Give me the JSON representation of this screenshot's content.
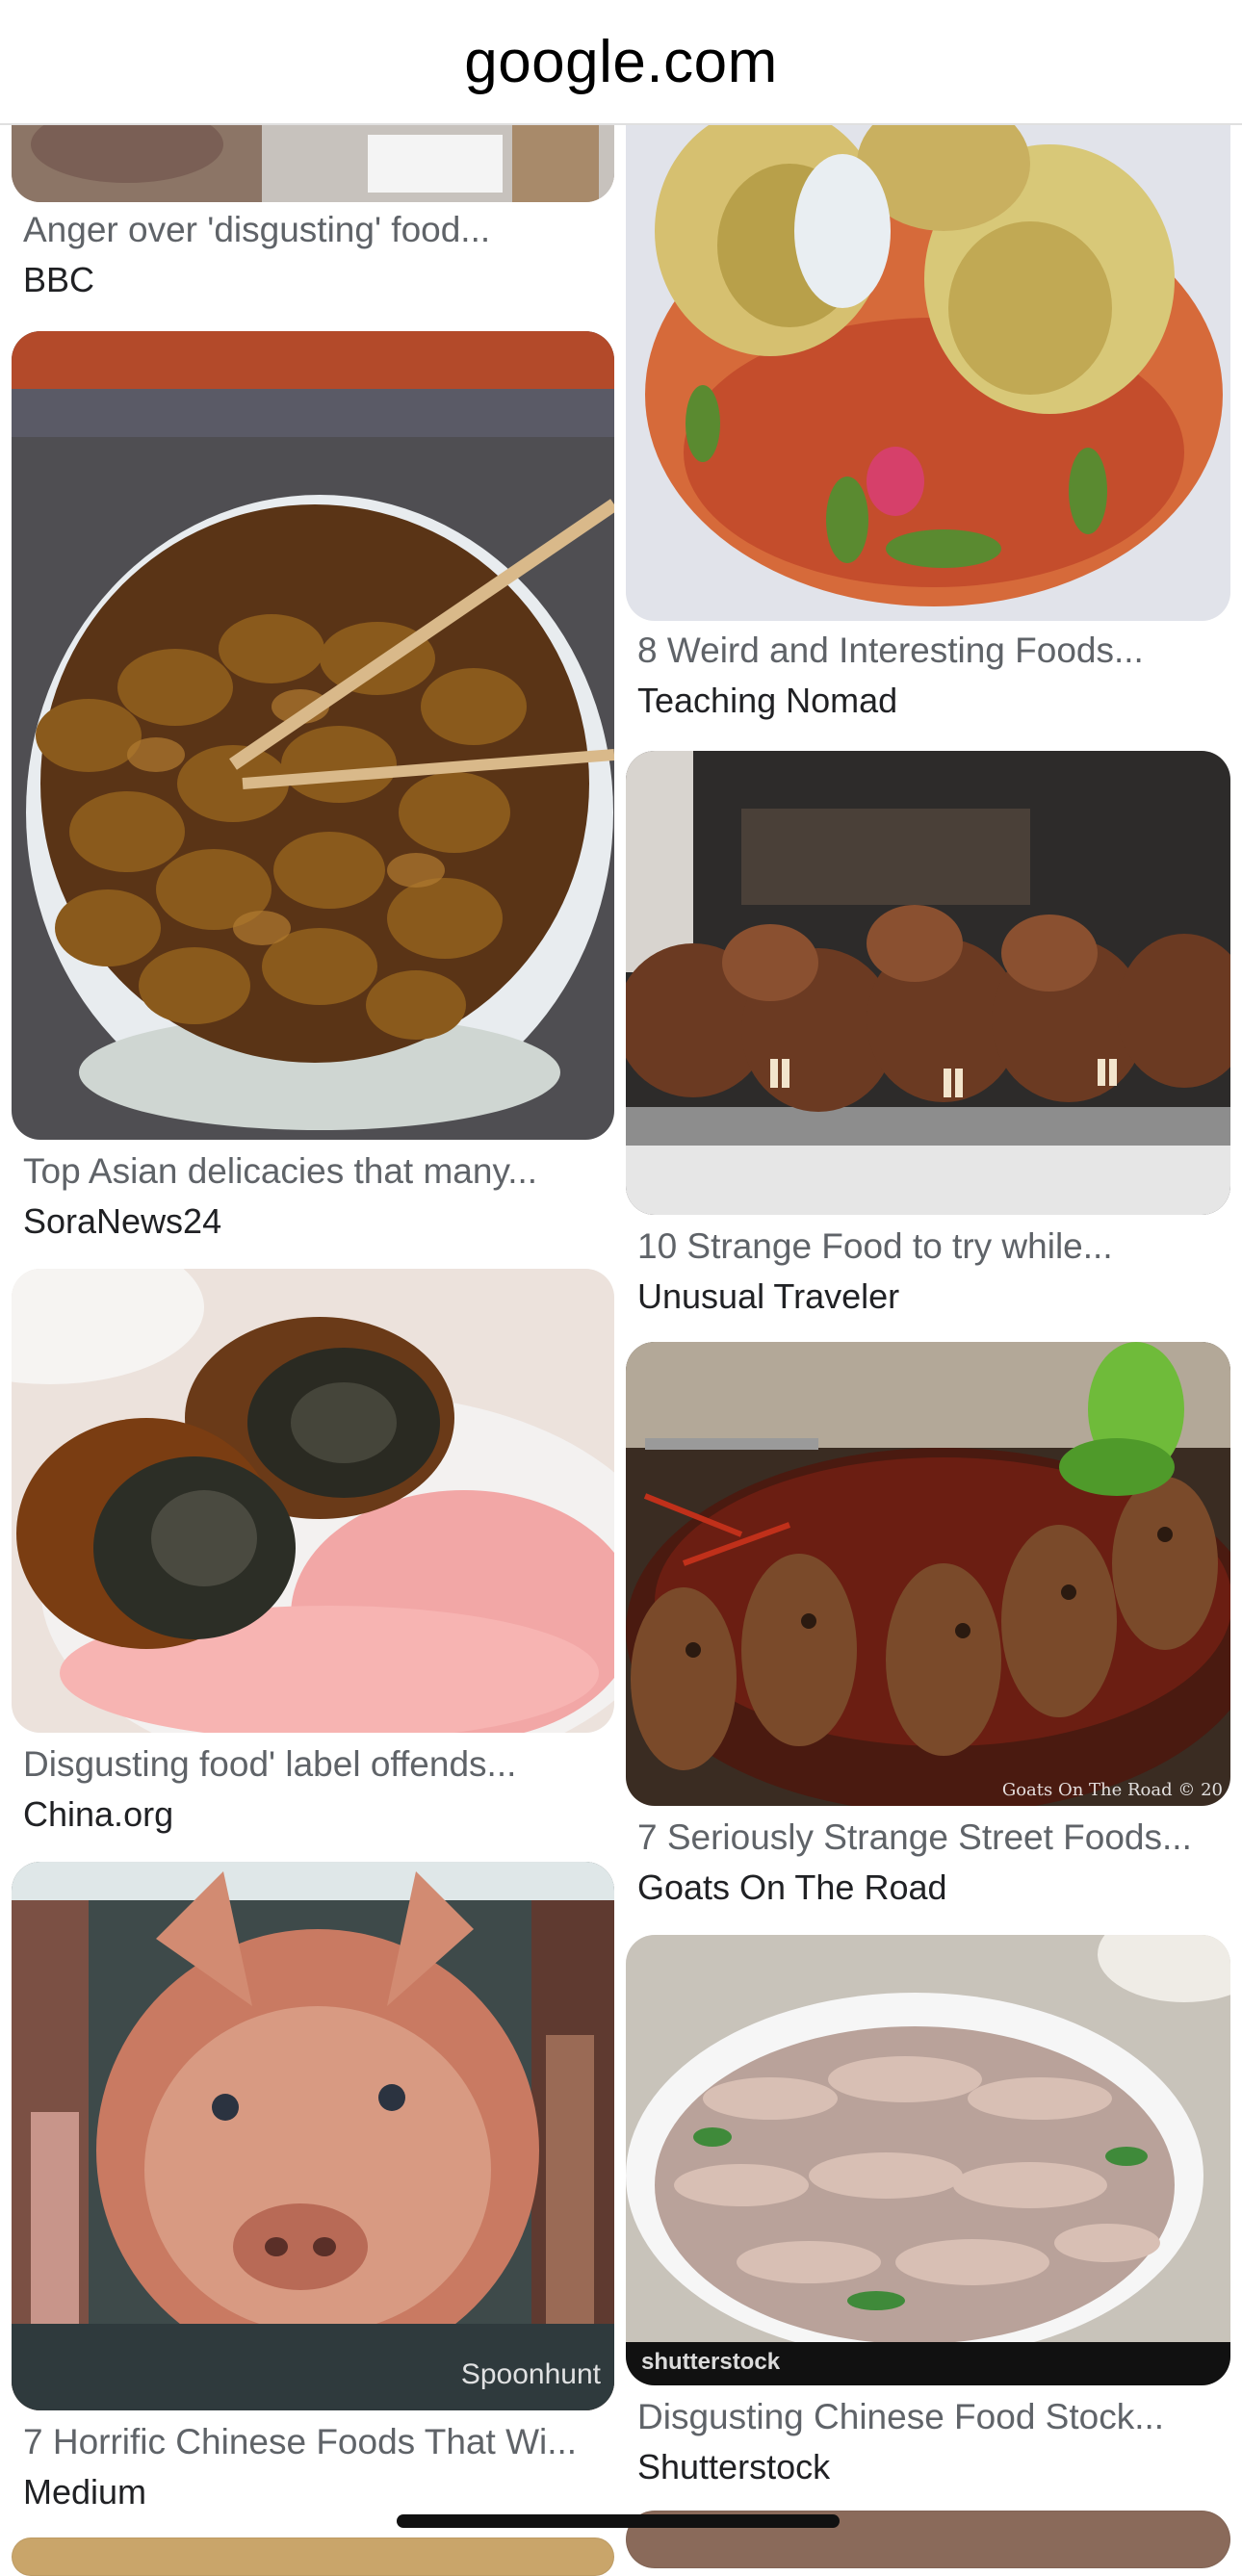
{
  "browser": {
    "domain": "google.com"
  },
  "results": [
    {
      "title": "Anger over 'disgusting' food...",
      "source": "BBC",
      "image": "food-photo"
    },
    {
      "title": "8 Weird and Interesting Foods...",
      "source": "Teaching Nomad",
      "image": "balut-eggs-photo"
    },
    {
      "title": "Top Asian delicacies that many...",
      "source": "SoraNews24",
      "image": "silkworm-pupae-photo"
    },
    {
      "title": "10 Strange Food to try while...",
      "source": "Unusual Traveler",
      "image": "rabbit-heads-photo"
    },
    {
      "title": "Disgusting food' label offends...",
      "source": "China.org",
      "image": "century-eggs-photo"
    },
    {
      "title": "7 Seriously Strange Street Foods...",
      "source": "Goats On The Road",
      "image": "duck-heads-photo",
      "watermark": "Goats On The Road © 20"
    },
    {
      "title": "7 Horrific Chinese Foods That Wi...",
      "source": "Medium",
      "image": "pig-head-photo",
      "watermark": "Spoonhunt"
    },
    {
      "title": "Disgusting Chinese Food Stock...",
      "source": "Shutterstock",
      "image": "intestines-photo",
      "watermark": "shutterstock"
    }
  ]
}
